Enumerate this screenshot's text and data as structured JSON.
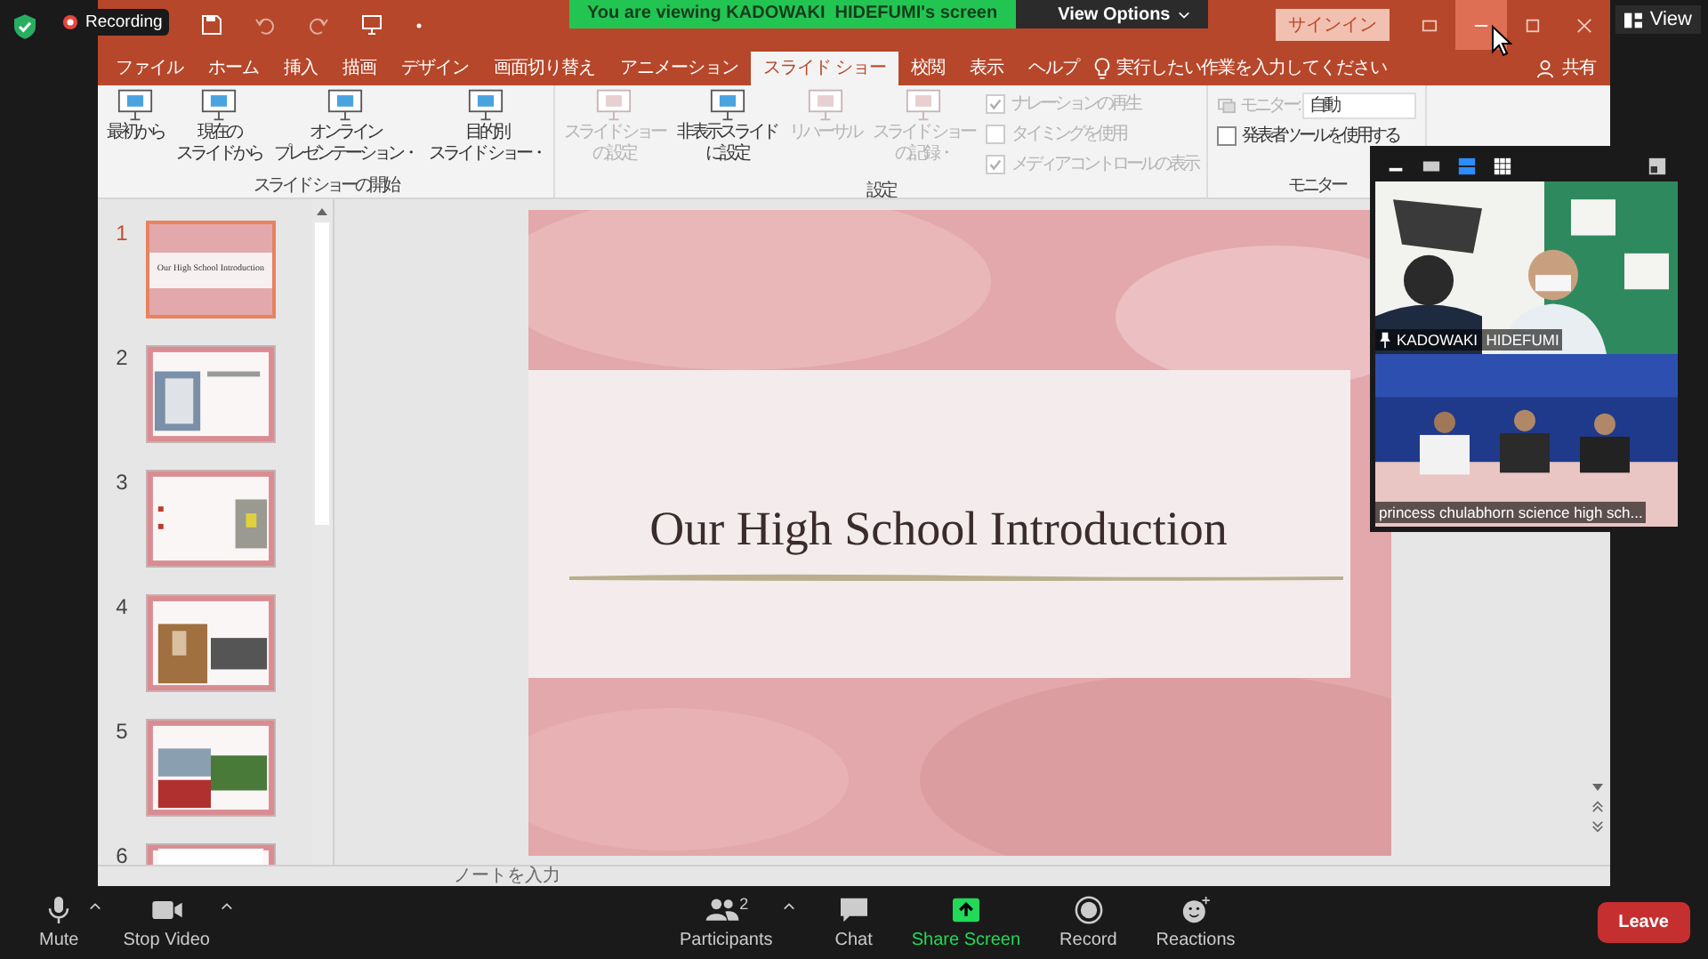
{
  "zoom": {
    "recording_label": "Recording",
    "banner": {
      "text": "You are viewing KADOWAKI  HIDEFUMI's screen",
      "options": "View Options"
    },
    "view_button": "View"
  },
  "ppt": {
    "sign_in": "サインイン",
    "window_controls": [
      {
        "kind": "ribbon-options",
        "hovered": false
      },
      {
        "kind": "minimize",
        "hovered": true
      },
      {
        "kind": "maximize",
        "hovered": false
      },
      {
        "kind": "close",
        "hovered": false
      }
    ],
    "tabs": [
      {
        "label": "ファイル",
        "selected": false
      },
      {
        "label": "ホーム",
        "selected": false
      },
      {
        "label": "挿入",
        "selected": false
      },
      {
        "label": "描画",
        "selected": false
      },
      {
        "label": "デザイン",
        "selected": false
      },
      {
        "label": "画面切り替え",
        "selected": false
      },
      {
        "label": "アニメーション",
        "selected": false
      },
      {
        "label": "スライド ショー",
        "selected": true
      },
      {
        "label": "校閲",
        "selected": false
      },
      {
        "label": "表示",
        "selected": false
      },
      {
        "label": "ヘルプ",
        "selected": false
      }
    ],
    "tell_me": "実行したい作業を入力してください",
    "share": "共有",
    "ribbon_groups": [
      {
        "label": "スライド ショーの開始",
        "items": [
          {
            "kind": "button",
            "lines": [
              "最初から"
            ],
            "disabled": false
          },
          {
            "kind": "button",
            "lines": [
              "現在の",
              "スライドから"
            ],
            "disabled": false
          },
          {
            "kind": "button",
            "lines": [
              "オンライン",
              "プレゼンテーション・"
            ],
            "disabled": false
          },
          {
            "kind": "button",
            "lines": [
              "目的別",
              "スライド ショー・"
            ],
            "disabled": false
          }
        ]
      },
      {
        "label": "設定",
        "items": [
          {
            "kind": "button",
            "lines": [
              "スライド ショー",
              "の設定"
            ],
            "disabled": true
          },
          {
            "kind": "button",
            "lines": [
              "非表示スライド",
              "に設定"
            ],
            "disabled": false
          },
          {
            "kind": "button",
            "lines": [
              "リハーサル"
            ],
            "disabled": true
          },
          {
            "kind": "button",
            "lines": [
              "スライド ショー",
              "の記録・"
            ],
            "disabled": true
          },
          {
            "kind": "checklist",
            "checks": [
              {
                "label": "ナレーションの再生",
                "checked": true,
                "disabled": true
              },
              {
                "label": "タイミングを使用",
                "checked": false,
                "disabled": true
              },
              {
                "label": "メディア コントロールの表示",
                "checked": true,
                "disabled": true
              }
            ]
          }
        ]
      },
      {
        "label": "モニター",
        "items": [
          {
            "kind": "monitor",
            "label": "モニター:",
            "value": "自動",
            "disabled": true
          },
          {
            "kind": "checklist",
            "checks": [
              {
                "label": "発表者ツールを使用する",
                "checked": false,
                "disabled": false
              }
            ]
          }
        ]
      }
    ],
    "thumbnails": [
      {
        "number": "1",
        "selected": true,
        "title": "Our High School Introduction"
      },
      {
        "number": "2",
        "selected": false
      },
      {
        "number": "3",
        "selected": false
      },
      {
        "number": "4",
        "selected": false
      },
      {
        "number": "5",
        "selected": false
      },
      {
        "number": "6",
        "selected": false
      }
    ],
    "slide": {
      "title": "Our High School Introduction"
    },
    "notes": {
      "placeholder": "ノートを入力"
    }
  },
  "video_panel": {
    "tiles": [
      {
        "name": "KADOWAKI  HIDEFUMI",
        "pinned": true
      },
      {
        "name": "princess chulabhorn science high sch...",
        "pinned": false
      }
    ]
  },
  "toolbar": {
    "left": [
      {
        "kind": "mic",
        "label": "Mute",
        "caret": true
      },
      {
        "kind": "video",
        "label": "Stop Video",
        "caret": true
      }
    ],
    "center": [
      {
        "kind": "participants",
        "label": "Participants",
        "count": "2",
        "caret": true,
        "highlighted": false
      },
      {
        "kind": "chat",
        "label": "Chat",
        "caret": false,
        "highlighted": false
      },
      {
        "kind": "share",
        "label": "Share Screen",
        "caret": false,
        "highlighted": true
      },
      {
        "kind": "record",
        "label": "Record",
        "caret": false,
        "highlighted": false
      },
      {
        "kind": "reactions",
        "label": "Reactions",
        "caret": false,
        "highlighted": false
      }
    ],
    "leave": "Leave"
  }
}
